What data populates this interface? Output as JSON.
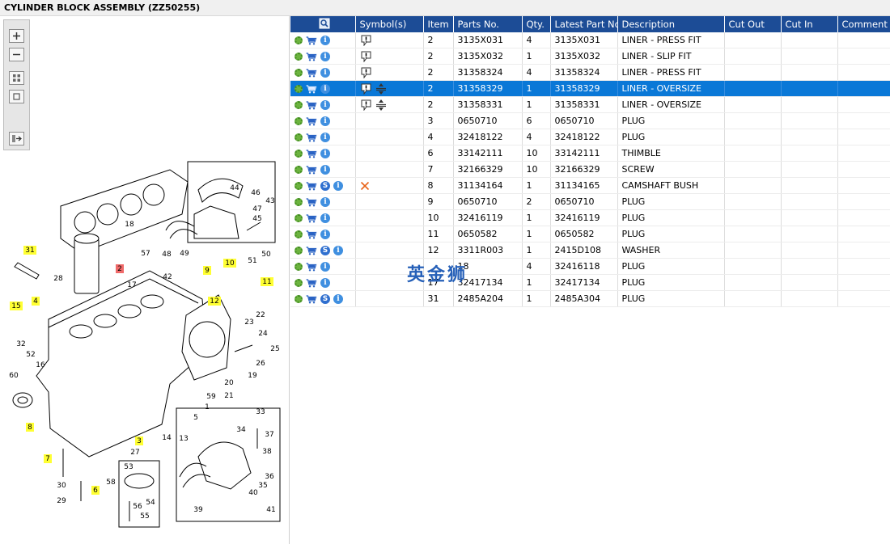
{
  "window": {
    "title": "CYLINDER BLOCK ASSEMBLY (ZZ50255)"
  },
  "toolbar": {
    "buttons": [
      "zoom-in",
      "zoom-out",
      "fit-all",
      "fit-window",
      "toggle-pane"
    ]
  },
  "diagram": {
    "callouts": [
      "31",
      "2",
      "57",
      "28",
      "17",
      "9",
      "10",
      "11",
      "4",
      "15",
      "12",
      "18",
      "44",
      "46",
      "43",
      "47",
      "45",
      "48",
      "49",
      "42",
      "51",
      "50",
      "22",
      "23",
      "24",
      "25",
      "26",
      "19",
      "20",
      "21",
      "59",
      "32",
      "52",
      "16",
      "60",
      "1",
      "5",
      "3",
      "14",
      "13",
      "8",
      "27",
      "7",
      "58",
      "6",
      "30",
      "29",
      "53",
      "54",
      "56",
      "55",
      "33",
      "34",
      "37",
      "38",
      "36",
      "35",
      "39",
      "40",
      "41"
    ],
    "highlighted": [
      "31",
      "10",
      "11",
      "4",
      "15",
      "12",
      "9",
      "3",
      "8",
      "7",
      "6"
    ],
    "red": [
      "2"
    ]
  },
  "grid": {
    "columns": [
      "",
      "Symbol(s)",
      "Item",
      "Parts No.",
      "Qty.",
      "Latest Part No.",
      "Description",
      "Cut Out",
      "Cut In",
      "Comment"
    ],
    "rows": [
      {
        "item": "2",
        "part": "3135X031",
        "qty": "4",
        "latest": "3135X031",
        "desc": "LINER - PRESS FIT",
        "s": false,
        "sym": "pin",
        "sel": false
      },
      {
        "item": "2",
        "part": "3135X032",
        "qty": "1",
        "latest": "3135X032",
        "desc": "LINER - SLIP FIT",
        "s": false,
        "sym": "pin",
        "sel": false
      },
      {
        "item": "2",
        "part": "31358324",
        "qty": "4",
        "latest": "31358324",
        "desc": "LINER - PRESS FIT",
        "s": false,
        "sym": "pin",
        "sel": false
      },
      {
        "item": "2",
        "part": "31358329",
        "qty": "1",
        "latest": "31358329",
        "desc": "LINER - OVERSIZE",
        "s": false,
        "sym": "pin-size",
        "sel": true
      },
      {
        "item": "2",
        "part": "31358331",
        "qty": "1",
        "latest": "31358331",
        "desc": "LINER - OVERSIZE",
        "s": false,
        "sym": "pin-size",
        "sel": false
      },
      {
        "item": "3",
        "part": "0650710",
        "qty": "6",
        "latest": "0650710",
        "desc": "PLUG",
        "s": false,
        "sym": "",
        "sel": false
      },
      {
        "item": "4",
        "part": "32418122",
        "qty": "4",
        "latest": "32418122",
        "desc": "PLUG",
        "s": false,
        "sym": "",
        "sel": false
      },
      {
        "item": "6",
        "part": "33142111",
        "qty": "10",
        "latest": "33142111",
        "desc": "THIMBLE",
        "s": false,
        "sym": "",
        "sel": false
      },
      {
        "item": "7",
        "part": "32166329",
        "qty": "10",
        "latest": "32166329",
        "desc": "SCREW",
        "s": false,
        "sym": "",
        "sel": false
      },
      {
        "item": "8",
        "part": "31134164",
        "qty": "1",
        "latest": "31134165",
        "desc": "CAMSHAFT BUSH",
        "s": true,
        "sym": "cross",
        "sel": false
      },
      {
        "item": "9",
        "part": "0650710",
        "qty": "2",
        "latest": "0650710",
        "desc": "PLUG",
        "s": false,
        "sym": "",
        "sel": false
      },
      {
        "item": "10",
        "part": "32416119",
        "qty": "1",
        "latest": "32416119",
        "desc": "PLUG",
        "s": false,
        "sym": "",
        "sel": false
      },
      {
        "item": "11",
        "part": "0650582",
        "qty": "1",
        "latest": "0650582",
        "desc": "PLUG",
        "s": false,
        "sym": "",
        "sel": false
      },
      {
        "item": "12",
        "part": "3311R003",
        "qty": "1",
        "latest": "2415D108",
        "desc": "WASHER",
        "s": true,
        "sym": "",
        "sel": false
      },
      {
        "item": "",
        "part": "18",
        "qty": "4",
        "latest": "32416118",
        "desc": "PLUG",
        "s": false,
        "sym": "",
        "sel": false
      },
      {
        "item": "17",
        "part": "32417134",
        "qty": "1",
        "latest": "32417134",
        "desc": "PLUG",
        "s": false,
        "sym": "",
        "sel": false
      },
      {
        "item": "31",
        "part": "2485A204",
        "qty": "1",
        "latest": "2485A304",
        "desc": "PLUG",
        "s": true,
        "sym": "",
        "sel": false
      }
    ]
  },
  "watermark": "英金狮"
}
